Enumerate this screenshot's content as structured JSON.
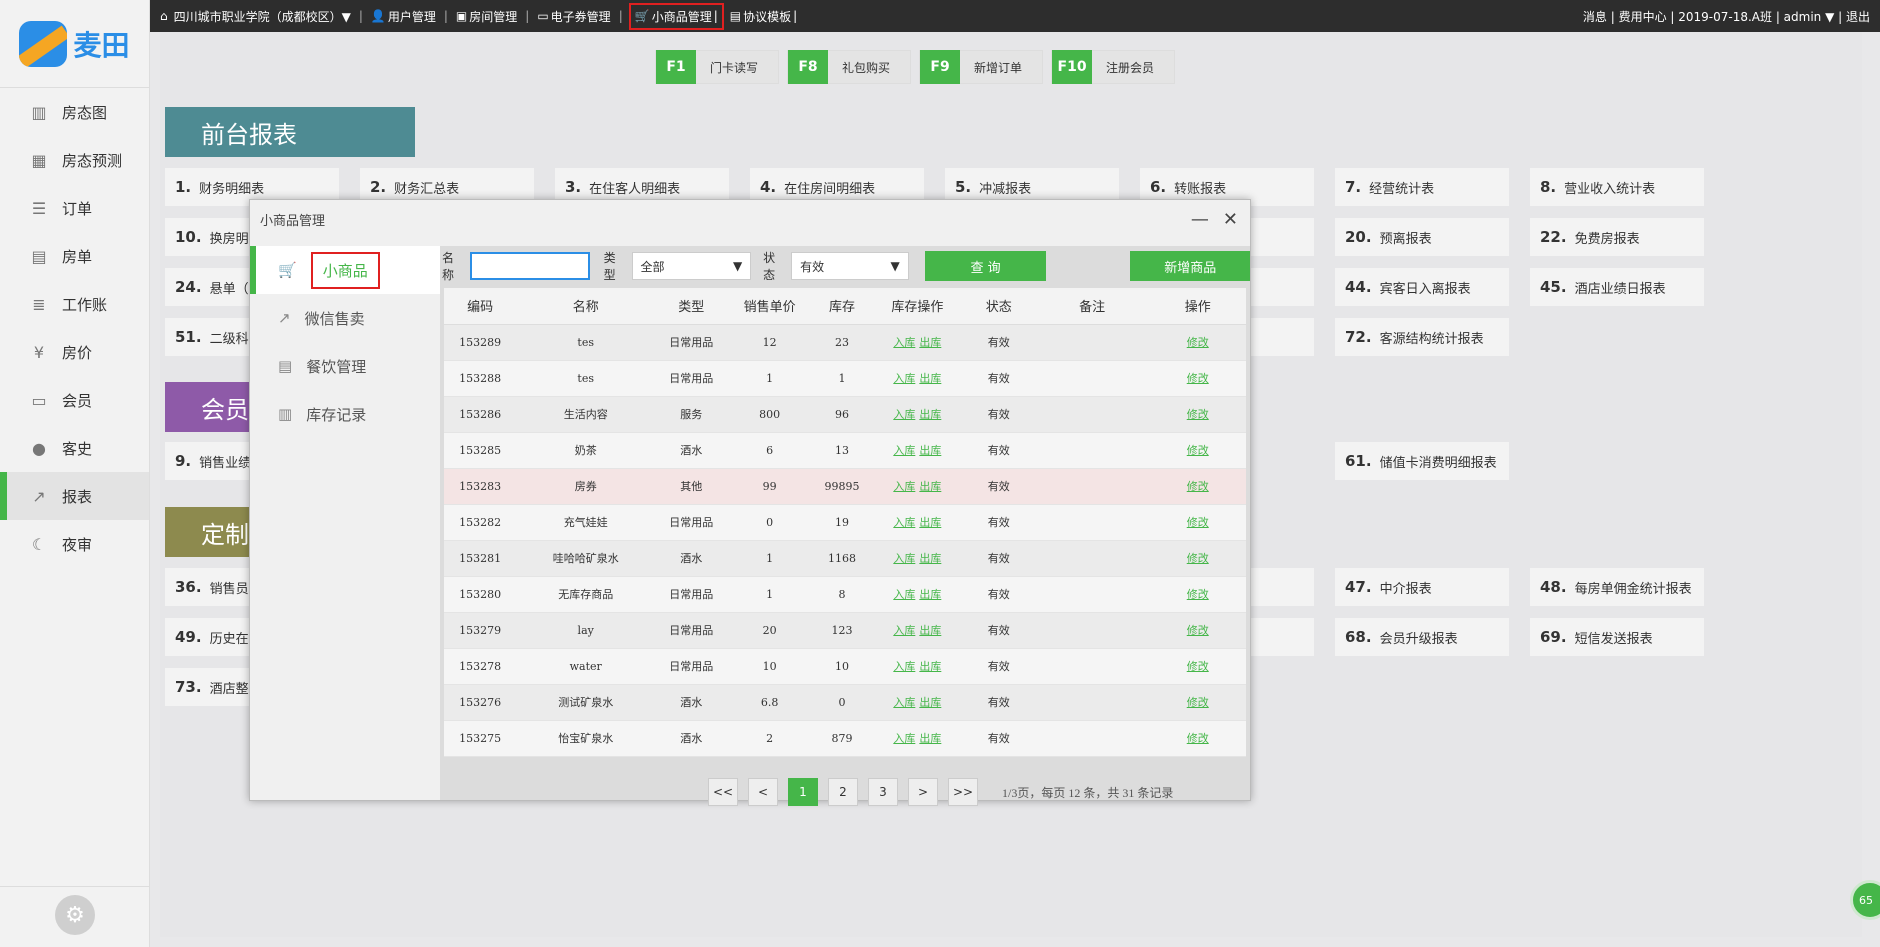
{
  "brand": {
    "name": "麦田"
  },
  "sidebar": {
    "items": [
      {
        "label": "房态图",
        "icon": "building-icon"
      },
      {
        "label": "房态预测",
        "icon": "chart-bar-icon"
      },
      {
        "label": "订单",
        "icon": "order-icon"
      },
      {
        "label": "房单",
        "icon": "document-icon"
      },
      {
        "label": "工作账",
        "icon": "ledger-icon"
      },
      {
        "label": "房价",
        "icon": "price-icon"
      },
      {
        "label": "会员",
        "icon": "card-icon"
      },
      {
        "label": "客史",
        "icon": "user-icon"
      },
      {
        "label": "报表",
        "icon": "trend-icon"
      },
      {
        "label": "夜审",
        "icon": "moon-icon"
      }
    ],
    "active": "报表"
  },
  "topbar": {
    "hotel": "四川城市职业学院（成都校区）▼",
    "menu": [
      "用户管理",
      "房间管理",
      "电子券管理",
      "小商品管理",
      "协议模板"
    ],
    "right": "消息 | 费用中心 | 2019-07-18.A班 | admin ▼ | 退出"
  },
  "fkeys": [
    {
      "key": "F1",
      "label": "门卡读写"
    },
    {
      "key": "F8",
      "label": "礼包购买"
    },
    {
      "key": "F9",
      "label": "新增订单"
    },
    {
      "key": "F10",
      "label": "注册会员"
    }
  ],
  "sections": {
    "front": "前台报表",
    "member": "会员",
    "custom": "定制"
  },
  "report_cards": [
    {
      "n": "1.",
      "t": "财务明细表"
    },
    {
      "n": "2.",
      "t": "财务汇总表"
    },
    {
      "n": "3.",
      "t": "在住客人明细表"
    },
    {
      "n": "4.",
      "t": "在住房间明细表"
    },
    {
      "n": "5.",
      "t": "冲减报表"
    },
    {
      "n": "6.",
      "t": "转账报表"
    },
    {
      "n": "7.",
      "t": "经营统计表"
    },
    {
      "n": "8.",
      "t": "营业收入统计表"
    },
    {
      "n": "10.",
      "t": "换房明"
    },
    {
      "n": "",
      "t": "计表"
    },
    {
      "n": "20.",
      "t": "预离报表"
    },
    {
      "n": "22.",
      "t": "免费房报表"
    },
    {
      "n": "24.",
      "t": "悬单（"
    },
    {
      "n": "",
      "t": "史明细表"
    },
    {
      "n": "44.",
      "t": "宾客日入离报表"
    },
    {
      "n": "45.",
      "t": "酒店业绩日报表"
    },
    {
      "n": "51.",
      "t": "二级科目"
    },
    {
      "n": "",
      "t": "计报表"
    },
    {
      "n": "72.",
      "t": "客源结构统计报表"
    },
    {
      "n": "9.",
      "t": "销售业绩"
    },
    {
      "n": "61.",
      "t": "储值卡消费明细报表"
    },
    {
      "n": "36.",
      "t": "销售员"
    },
    {
      "n": "",
      "t": "报表"
    },
    {
      "n": "47.",
      "t": "中介报表"
    },
    {
      "n": "48.",
      "t": "每房单佣金统计报表"
    },
    {
      "n": "49.",
      "t": "历史在住"
    },
    {
      "n": "",
      "t": "表"
    },
    {
      "n": "68.",
      "t": "会员升级报表"
    },
    {
      "n": "69.",
      "t": "短信发送报表"
    },
    {
      "n": "73.",
      "t": "酒店整"
    }
  ],
  "modal": {
    "title": "小商品管理",
    "nav": [
      "小商品",
      "微信售卖",
      "餐饮管理",
      "库存记录"
    ],
    "filter": {
      "name_label": "名称",
      "name_value": "",
      "type_label": "类型",
      "type_value": "全部",
      "status_label": "状态",
      "status_value": "有效",
      "query": "查 询",
      "add": "新增商品"
    },
    "columns": [
      "编码",
      "名称",
      "类型",
      "销售单价",
      "库存",
      "库存操作",
      "状态",
      "备注",
      "操作"
    ],
    "rows": [
      {
        "code": "153289",
        "name": "tes",
        "type": "日常用品",
        "price": "12",
        "stock": "23",
        "status": "有效",
        "note": ""
      },
      {
        "code": "153288",
        "name": "tes",
        "type": "日常用品",
        "price": "1",
        "stock": "1",
        "status": "有效",
        "note": ""
      },
      {
        "code": "153286",
        "name": "生活内容",
        "type": "服务",
        "price": "800",
        "stock": "96",
        "status": "有效",
        "note": ""
      },
      {
        "code": "153285",
        "name": "奶茶",
        "type": "酒水",
        "price": "6",
        "stock": "13",
        "status": "有效",
        "note": ""
      },
      {
        "code": "153283",
        "name": "房券",
        "type": "其他",
        "price": "99",
        "stock": "99895",
        "status": "有效",
        "note": ""
      },
      {
        "code": "153282",
        "name": "充气娃娃",
        "type": "日常用品",
        "price": "0",
        "stock": "19",
        "status": "有效",
        "note": ""
      },
      {
        "code": "153281",
        "name": "哇哈哈矿泉水",
        "type": "酒水",
        "price": "1",
        "stock": "1168",
        "status": "有效",
        "note": ""
      },
      {
        "code": "153280",
        "name": "无库存商品",
        "type": "日常用品",
        "price": "1",
        "stock": "8",
        "status": "有效",
        "note": ""
      },
      {
        "code": "153279",
        "name": "lay",
        "type": "日常用品",
        "price": "20",
        "stock": "123",
        "status": "有效",
        "note": ""
      },
      {
        "code": "153278",
        "name": "water",
        "type": "日常用品",
        "price": "10",
        "stock": "10",
        "status": "有效",
        "note": ""
      },
      {
        "code": "153276",
        "name": "测试矿泉水",
        "type": "酒水",
        "price": "6.8",
        "stock": "0",
        "status": "有效",
        "note": ""
      },
      {
        "code": "153275",
        "name": "怡宝矿泉水",
        "type": "酒水",
        "price": "2",
        "stock": "879",
        "status": "有效",
        "note": ""
      }
    ],
    "op_in": "入库",
    "op_out": "出库",
    "op_edit": "修改",
    "pager": {
      "buttons": [
        "<<",
        "<",
        "1",
        "2",
        "3",
        ">",
        ">>"
      ],
      "current": "1",
      "info": "1/3页，每页 12 条，共 31 条记录"
    }
  },
  "float_badge": "65",
  "colors": {
    "accent": "#45b649",
    "front": "#4e8b93",
    "member": "#8e5aa8",
    "custom": "#8d8a4e",
    "highlight": "#e02020"
  }
}
